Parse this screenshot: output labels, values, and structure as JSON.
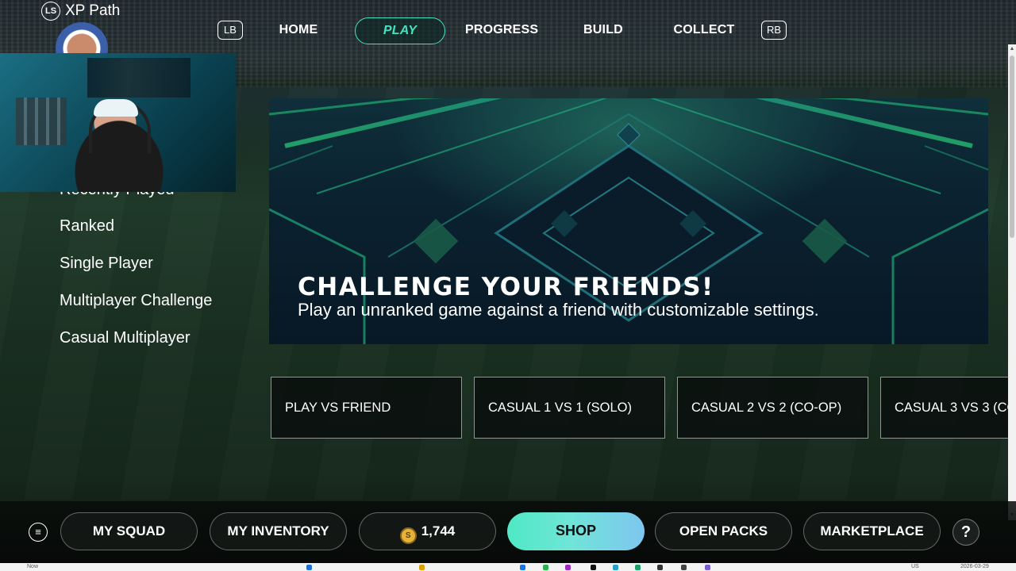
{
  "nav": {
    "xp_label": "XP Path",
    "ls_icon": "LS",
    "lb": "LB",
    "rb": "RB",
    "items": [
      "HOME",
      "PLAY",
      "PROGRESS",
      "BUILD",
      "COLLECT"
    ],
    "active": "PLAY"
  },
  "left_menu": {
    "items": [
      "Recently Played",
      "Ranked",
      "Single Player",
      "Multiplayer Challenge",
      "Casual Multiplayer"
    ]
  },
  "hero": {
    "title": "CHALLENGE YOUR FRIENDS!",
    "subtitle": "Play an unranked game against a friend with customizable settings."
  },
  "cards": [
    "PLAY VS FRIEND",
    "CASUAL 1 VS 1 (SOLO)",
    "CASUAL 2 VS 2 (CO-OP)",
    "CASUAL 3 VS 3 (CO"
  ],
  "bottom": {
    "menu_icon": "≡",
    "my_squad": "MY SQUAD",
    "my_inventory": "MY INVENTORY",
    "coins": "1,744",
    "coin_symbol": "S",
    "shop": "SHOP",
    "open_packs": "OPEN PACKS",
    "marketplace": "MARKETPLACE",
    "help": "?"
  },
  "taskbar": {
    "left_text": "Now",
    "lang": "US",
    "date": "2026-03-29"
  },
  "colors": {
    "accent": "#46e3c1",
    "shop_gradient_start": "#4fe8c4",
    "shop_gradient_end": "#7ec6ef"
  }
}
